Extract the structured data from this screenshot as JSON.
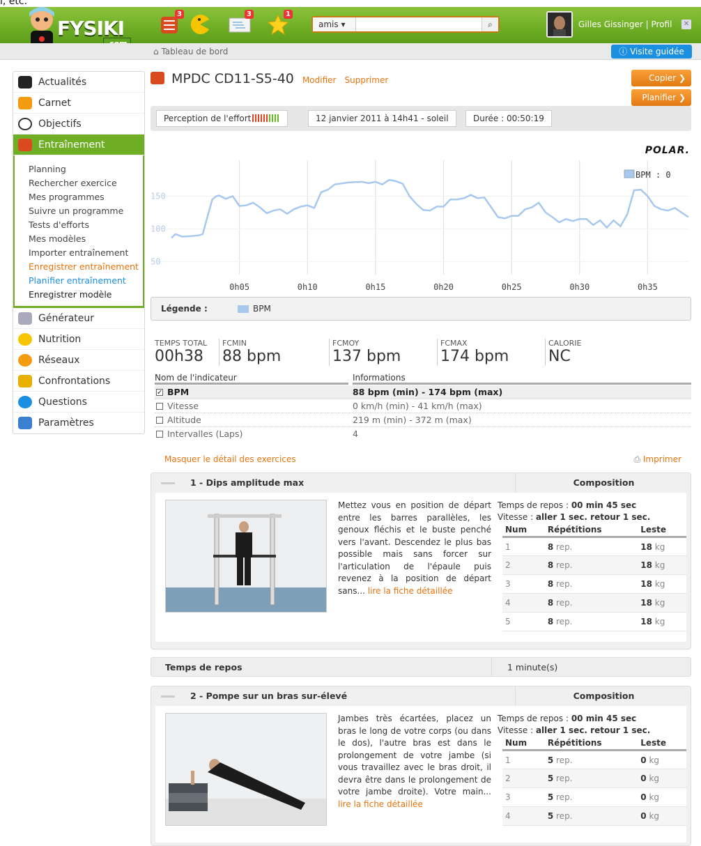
{
  "top_cut": "l, etc.",
  "header": {
    "logo_text": "FYSIKI",
    "logo_sub": ".com",
    "notif_badges": [
      "3",
      "3",
      "1"
    ],
    "search": {
      "select_value": "amis",
      "placeholder": ""
    },
    "user_name": "Gilles Gissinger",
    "profile_link": "Profil",
    "separator": "|"
  },
  "subbar": {
    "breadcrumb": "Tableau de bord",
    "visite": "Visite guidée"
  },
  "sidebar": {
    "items": [
      {
        "label": "Actualités",
        "icon": "house-icon",
        "color": "#222"
      },
      {
        "label": "Carnet",
        "icon": "bars-icon",
        "color": "#f39c12"
      },
      {
        "label": "Objectifs",
        "icon": "stopwatch-icon",
        "color": "#333"
      },
      {
        "label": "Entraînement",
        "icon": "notebook-icon",
        "color": "#d94a1f"
      },
      {
        "label": "Générateur",
        "icon": "gear-icon",
        "color": "#aab"
      },
      {
        "label": "Nutrition",
        "icon": "pacman-icon",
        "color": "#f7b500"
      },
      {
        "label": "Réseaux",
        "icon": "people-icon",
        "color": "#f39c12"
      },
      {
        "label": "Confrontations",
        "icon": "trophy-icon",
        "color": "#e8b000"
      },
      {
        "label": "Questions",
        "icon": "info-icon",
        "color": "#1b8fe0"
      },
      {
        "label": "Paramètres",
        "icon": "jar-icon",
        "color": "#3a7fd0"
      }
    ],
    "subnav": [
      "Planning",
      "Rechercher exercice",
      "Mes programmes",
      "Suivre un programme",
      "Tests d'efforts",
      "Mes modèles",
      "Importer entraînement",
      "Enregistrer entraînement",
      "Planifier entraînement",
      "Enregistrer modèle"
    ]
  },
  "main": {
    "title": "MPDC CD11-S5-40",
    "modifier": "Modifier",
    "supprimer": "Supprimer",
    "copier": "Copier",
    "planifier": "Planifier",
    "perception": "Perception de l'effort",
    "date": "12 janvier 2011 à 14h41 - soleil",
    "duree": "Durée : 00:50:19",
    "polar": "POLAR.",
    "legend_label": "Légende :",
    "legend_series": "BPM"
  },
  "chart_data": {
    "type": "line",
    "title": "",
    "xlabel": "",
    "ylabel": "",
    "ylim": [
      30,
      205
    ],
    "xlim": [
      0,
      38
    ],
    "yticks": [
      50,
      100,
      150
    ],
    "xticks": [
      "0h05",
      "0h10",
      "0h15",
      "0h20",
      "0h25",
      "0h30",
      "0h35"
    ],
    "series": [
      {
        "name": "BPM",
        "legend_text": "BPM : 0",
        "color": "#a8c8ee",
        "x": [
          0,
          0.3,
          0.8,
          1.5,
          2,
          2.3,
          3,
          3.3,
          3.5,
          4,
          4.5,
          5,
          5.5,
          6,
          6.5,
          7,
          7.5,
          8,
          8.5,
          9,
          9.5,
          10,
          10.5,
          11,
          11.5,
          12,
          13,
          14,
          14.5,
          15,
          15.5,
          16,
          16.5,
          17,
          17.5,
          18,
          18.5,
          19,
          19.5,
          20,
          20.5,
          21,
          21.5,
          22,
          22.5,
          23,
          23.5,
          24,
          24.5,
          25,
          25.5,
          26,
          26.5,
          27,
          27.5,
          28,
          28.5,
          29,
          29.5,
          30,
          30.5,
          31,
          31.5,
          32,
          32.5,
          33,
          33.5,
          34,
          34.5,
          35,
          35.5,
          36,
          36.5,
          37,
          37.5,
          38
        ],
        "y": [
          86,
          92,
          88,
          89,
          90,
          92,
          145,
          150,
          151,
          146,
          150,
          135,
          136,
          140,
          133,
          124,
          128,
          130,
          123,
          130,
          134,
          136,
          132,
          156,
          160,
          168,
          171,
          172,
          170,
          172,
          168,
          175,
          173,
          169,
          150,
          138,
          129,
          128,
          134,
          134,
          145,
          145,
          147,
          152,
          147,
          148,
          133,
          118,
          116,
          120,
          120,
          130,
          133,
          140,
          125,
          118,
          110,
          115,
          112,
          115,
          115,
          106,
          113,
          102,
          113,
          104,
          122,
          159,
          160,
          150,
          135,
          130,
          128,
          132,
          125,
          118
        ]
      }
    ]
  },
  "stats": [
    {
      "label": "TEMPS TOTAL",
      "value": "00h38"
    },
    {
      "label": "FCMIN",
      "value": "88 bpm"
    },
    {
      "label": "FCMOY",
      "value": "137 bpm"
    },
    {
      "label": "FCMAX",
      "value": "174 bpm"
    },
    {
      "label": "CALORIE",
      "value": "NC"
    }
  ],
  "indicators": {
    "col1": "Nom de l'indicateur",
    "col2": "Informations",
    "rows": [
      {
        "name": "BPM",
        "info": "88 bpm (min) - 174 bpm (max)",
        "checked": true,
        "mark": "✓"
      },
      {
        "name": "Vitesse",
        "info": "0 km/h (min) - 41 km/h (max)",
        "checked": false,
        "mark": ""
      },
      {
        "name": "Altitude",
        "info": "219 m (min) - 372 m (max)",
        "checked": false,
        "mark": ""
      },
      {
        "name": "Intervalles (Laps)",
        "info": "4",
        "checked": false,
        "mark": ""
      }
    ]
  },
  "links": {
    "masquer": "Masquer le détail des exercices",
    "imprimer": "Imprimer"
  },
  "exercises": [
    {
      "title": "1 - Dips amplitude max",
      "composition": "Composition",
      "desc": "Mettez vous en position de départ entre les barres parallèles, les genoux fléchis et le buste penché vers l'avant. Descendez le plus bas possible mais sans forcer sur l'articulation de l'épaule puis revenez à la position de départ sans...",
      "more": "lire la fiche détaillée",
      "repos_label": "Temps de repos :",
      "repos_value": "00 min 45 sec",
      "vitesse_label": "Vitesse :",
      "vitesse_value": "aller 1 sec. retour 1 sec.",
      "cols": [
        "Num",
        "Répétitions",
        "Leste"
      ],
      "rows": [
        {
          "num": "1",
          "reps": "8",
          "unit": "rep.",
          "leste": "18",
          "kg": "kg"
        },
        {
          "num": "2",
          "reps": "8",
          "unit": "rep.",
          "leste": "18",
          "kg": "kg"
        },
        {
          "num": "3",
          "reps": "8",
          "unit": "rep.",
          "leste": "18",
          "kg": "kg"
        },
        {
          "num": "4",
          "reps": "8",
          "unit": "rep.",
          "leste": "18",
          "kg": "kg"
        },
        {
          "num": "5",
          "reps": "8",
          "unit": "rep.",
          "leste": "18",
          "kg": "kg"
        }
      ]
    },
    {
      "title": "2 - Pompe sur un bras sur-élevé",
      "composition": "Composition",
      "desc": "Jambes très écartées, placez un bras le long de votre corps (ou dans le dos), l'autre bras est dans le prolongement de votre jambe (si vous travaillez avec le bras droit, il devra être dans le prolongement de votre jambe droite). Votre main...",
      "more": "lire la fiche détaillée",
      "repos_label": "Temps de repos :",
      "repos_value": "00 min 45 sec",
      "vitesse_label": "Vitesse :",
      "vitesse_value": "aller 1 sec. retour 1 sec.",
      "cols": [
        "Num",
        "Répétitions",
        "Leste"
      ],
      "rows": [
        {
          "num": "1",
          "reps": "5",
          "unit": "rep.",
          "leste": "0",
          "kg": "kg"
        },
        {
          "num": "2",
          "reps": "5",
          "unit": "rep.",
          "leste": "0",
          "kg": "kg"
        },
        {
          "num": "3",
          "reps": "5",
          "unit": "rep.",
          "leste": "0",
          "kg": "kg"
        },
        {
          "num": "4",
          "reps": "5",
          "unit": "rep.",
          "leste": "0",
          "kg": "kg"
        }
      ]
    }
  ],
  "rest": {
    "label": "Temps de repos",
    "value": "1 minute(s)"
  }
}
